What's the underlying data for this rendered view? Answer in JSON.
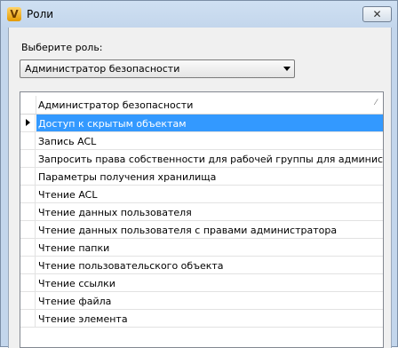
{
  "window": {
    "title": "Роли",
    "app_icon_glyph": "V",
    "close_glyph": "✕"
  },
  "role_picker": {
    "label": "Выберите роль:",
    "selected_value": "Администратор безопасности"
  },
  "grid": {
    "column_header": "Администратор безопасности",
    "sort_glyph": "⁄",
    "selected_index": 0,
    "rows": [
      "Доступ к скрытым объектам",
      "Запись ACL",
      "Запросить права собственности для рабочей группы для администратора",
      "Параметры получения хранилища",
      "Чтение ACL",
      "Чтение данных пользователя",
      "Чтение данных пользователя с правами администратора",
      "Чтение папки",
      "Чтение пользовательского объекта",
      "Чтение ссылки",
      "Чтение файла",
      "Чтение элемента"
    ]
  },
  "colors": {
    "selection": "#3399ff",
    "title_bar": "#c3d6ec"
  }
}
